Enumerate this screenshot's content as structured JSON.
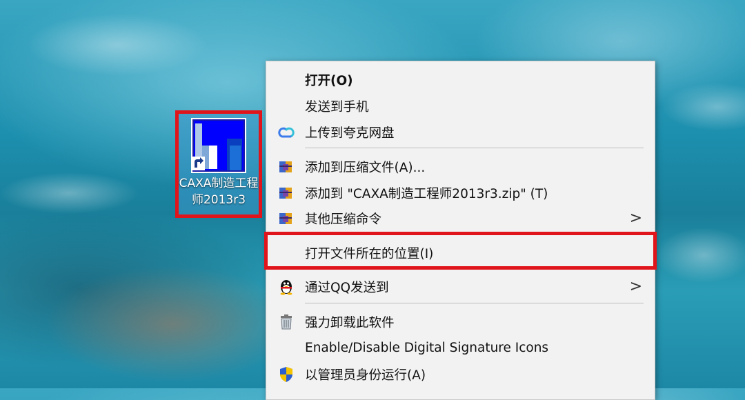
{
  "desktop": {
    "icon_label": "CAXA制造工程师2013r3",
    "icon_name": "caxa-app-icon"
  },
  "menu": {
    "items": [
      {
        "label": "打开(O)",
        "icon": "",
        "bold": true
      },
      {
        "label": "发送到手机",
        "icon": ""
      },
      {
        "label": "上传到夸克网盘",
        "icon": "cloud-upload-icon"
      },
      {
        "label": "添加到压缩文件(A)...",
        "icon": "winrar-icon"
      },
      {
        "label": "添加到 \"CAXA制造工程师2013r3.zip\" (T)",
        "icon": "winrar-icon"
      },
      {
        "label": "其他压缩命令",
        "icon": "winrar-icon",
        "submenu": true
      },
      {
        "label": "打开文件所在的位置(I)",
        "icon": ""
      },
      {
        "label": "通过QQ发送到",
        "icon": "qq-penguin-icon",
        "submenu": true
      },
      {
        "label": "强力卸载此软件",
        "icon": "trash-icon"
      },
      {
        "label": "Enable/Disable Digital Signature Icons",
        "icon": ""
      },
      {
        "label": "以管理员身份运行(A)",
        "icon": "uac-shield-icon"
      }
    ],
    "submenu_arrow": ">"
  },
  "colors": {
    "highlight_border": "#e0141b",
    "menu_bg": "#f2f2f2"
  }
}
